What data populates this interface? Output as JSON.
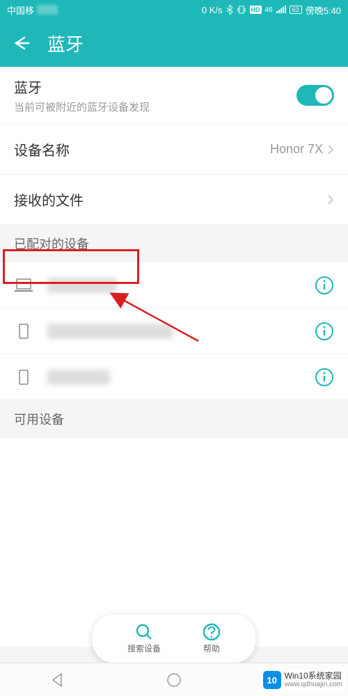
{
  "statusBar": {
    "carrier": "中国移",
    "speed": "0 K/s",
    "network": "46",
    "battery": "63",
    "time": "傍晚5:40"
  },
  "header": {
    "title": "蓝牙"
  },
  "bluetooth": {
    "label": "蓝牙",
    "subtitle": "当前可被附近的蓝牙设备发现"
  },
  "deviceName": {
    "label": "设备名称",
    "value": "Honor 7X"
  },
  "receivedFiles": {
    "label": "接收的文件"
  },
  "sections": {
    "paired": "已配对的设备",
    "available": "可用设备"
  },
  "bottomBar": {
    "search": "搜索设备",
    "help": "帮助"
  },
  "watermark": {
    "logo": "10",
    "line1": "Win10系统家园",
    "line2": "www.qdhuajin.com"
  }
}
